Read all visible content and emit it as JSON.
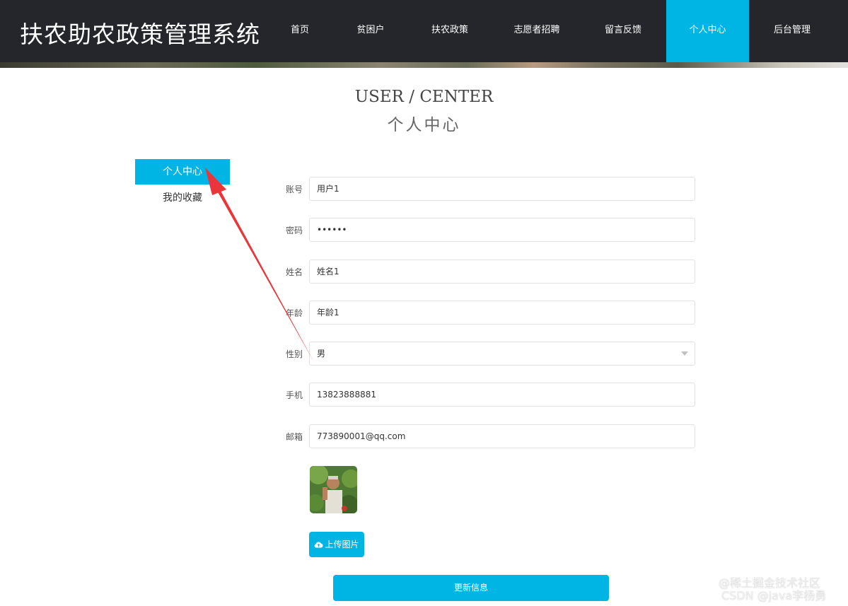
{
  "header": {
    "site_title": "扶农助农政策管理系统",
    "nav": [
      {
        "label": "首页"
      },
      {
        "label": "贫困户"
      },
      {
        "label": "扶农政策"
      },
      {
        "label": "志愿者招聘"
      },
      {
        "label": "留言反馈"
      },
      {
        "label": "个人中心",
        "active": true
      },
      {
        "label": "后台管理"
      }
    ]
  },
  "page_title": {
    "en": "USER / CENTER",
    "cn": "个人中心"
  },
  "sidebar": {
    "items": [
      {
        "label": "个人中心",
        "active": true
      },
      {
        "label": "我的收藏"
      }
    ]
  },
  "form": {
    "account": {
      "label": "账号",
      "value": "用户1"
    },
    "password": {
      "label": "密码",
      "value": "••••••"
    },
    "name": {
      "label": "姓名",
      "value": "姓名1"
    },
    "age": {
      "label": "年龄",
      "value": "年龄1"
    },
    "gender": {
      "label": "性别",
      "value": "男"
    },
    "phone": {
      "label": "手机",
      "value": "13823888881"
    },
    "email": {
      "label": "邮箱",
      "value": "773890001@qq.com"
    },
    "upload_label": "上传图片",
    "submit_label": "更新信息"
  },
  "watermark": {
    "line1": "@稀土掘金技术社区",
    "line2": "CSDN @java李杨勇"
  },
  "colors": {
    "accent": "#00b4e4",
    "header_bg": "#24262c",
    "annotation": "#e8363a"
  }
}
